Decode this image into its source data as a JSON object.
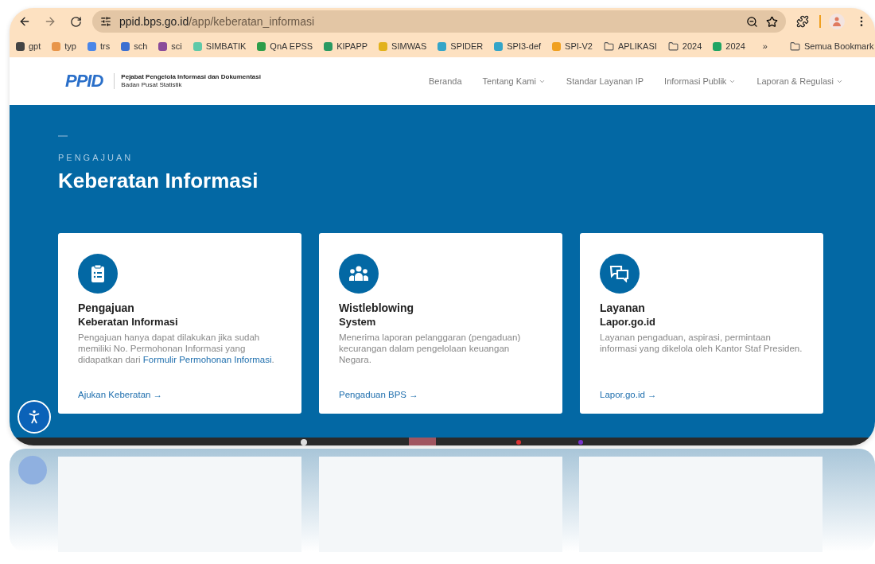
{
  "browser": {
    "url": {
      "host": "ppid.bps.go.id",
      "path": "/app/keberatan_informasi"
    }
  },
  "bookmarks": [
    {
      "label": "gpt",
      "kind": "site",
      "color": "#444444"
    },
    {
      "label": "typ",
      "kind": "site",
      "color": "#e8954a"
    },
    {
      "label": "trs",
      "kind": "site",
      "color": "#4a86e8"
    },
    {
      "label": "sch",
      "kind": "site",
      "color": "#3b6fd1"
    },
    {
      "label": "sci",
      "kind": "site",
      "color": "#8a4b9a"
    },
    {
      "label": "SIMBATIK",
      "kind": "site",
      "color": "#5fc9a8"
    },
    {
      "label": "QnA EPSS",
      "kind": "site",
      "color": "#2e9e4a"
    },
    {
      "label": "KIPAPP",
      "kind": "site",
      "color": "#2a9a62"
    },
    {
      "label": "SIMWAS",
      "kind": "site",
      "color": "#e2b21c"
    },
    {
      "label": "SPIDER",
      "kind": "site",
      "color": "#34a5c8"
    },
    {
      "label": "SPI3-def",
      "kind": "site",
      "color": "#34a5c8"
    },
    {
      "label": "SPI-V2",
      "kind": "site",
      "color": "#f0a020"
    },
    {
      "label": "APLIKASI",
      "kind": "folder"
    },
    {
      "label": "2024",
      "kind": "folder"
    },
    {
      "label": "2024",
      "kind": "site",
      "color": "#1fa463"
    }
  ],
  "bookmarks_more": "»",
  "bookmarks_all": "Semua Bookmark",
  "site": {
    "logo": "PPID",
    "org_name": "Pejabat Pengelola Informasi dan Dokumentasi",
    "org_sub": "Badan Pusat Statistik",
    "nav": [
      {
        "label": "Beranda",
        "dropdown": false
      },
      {
        "label": "Tentang Kami",
        "dropdown": true
      },
      {
        "label": "Standar Layanan IP",
        "dropdown": false
      },
      {
        "label": "Informasi Publik",
        "dropdown": true
      },
      {
        "label": "Laporan & Regulasi",
        "dropdown": true
      }
    ]
  },
  "hero": {
    "eyebrow": "PENGAJUAN",
    "title": "Keberatan Informasi"
  },
  "cards": [
    {
      "title": "Pengajuan",
      "subtitle": "Keberatan Informasi",
      "description": "Pengajuan hanya dapat dilakukan jika sudah memiliki No. Permohonan Informasi yang didapatkan dari ",
      "description_link": "Formulir Permohonan Informasi",
      "description_end": ".",
      "link": "Ajukan Keberatan →"
    },
    {
      "title": "Wistleblowing",
      "subtitle": "System",
      "description": "Menerima laporan pelanggaran (pengaduan) kecurangan dalam pengelolaan keuangan Negara.",
      "link": "Pengaduan BPS →"
    },
    {
      "title": "Layanan",
      "subtitle": "Lapor.go.id",
      "description": "Layanan pengaduan, aspirasi, permintaan informasi yang dikelola oleh Kantor Staf Presiden.",
      "link": "Lapor.go.id →"
    }
  ]
}
